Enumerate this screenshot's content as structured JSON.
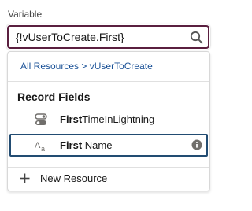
{
  "field": {
    "label": "Variable",
    "value": "{!vUserToCreate.First}"
  },
  "dropdown": {
    "breadcrumb": {
      "root": "All Resources",
      "separator": ">",
      "current": "vUserToCreate"
    },
    "section_heading": "Record Fields",
    "options": [
      {
        "match": "First",
        "rest": "TimeInLightning",
        "icon": "toggle-icon",
        "selected": false
      },
      {
        "match": "First",
        "rest": " Name",
        "icon": "text-field-icon",
        "selected": true,
        "has_info": true
      }
    ],
    "new_resource_label": "New Resource"
  },
  "colors": {
    "focus_border": "#5a1f3f",
    "selected_border": "#224c72",
    "link": "#1b5297",
    "icon_gray": "#706e6b"
  }
}
